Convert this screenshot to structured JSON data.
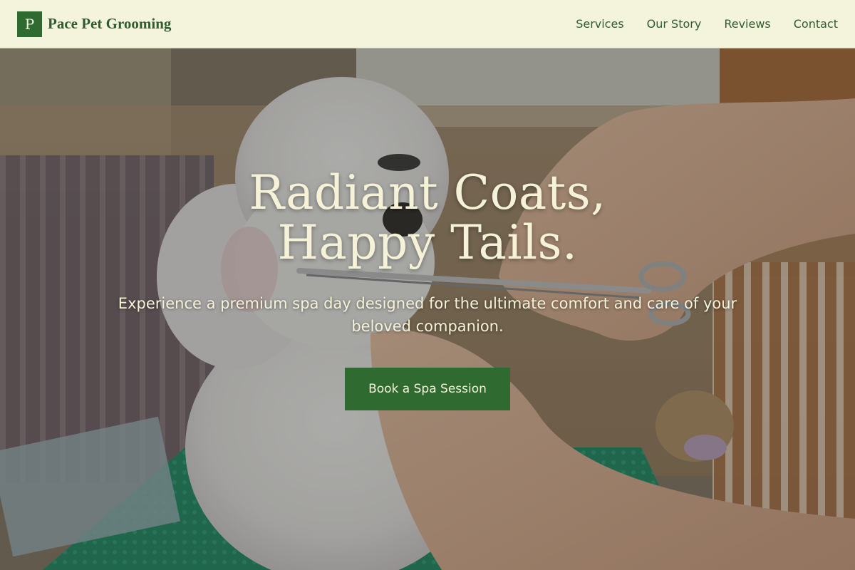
{
  "header": {
    "logo_letter": "P",
    "brand_name": "Pace Pet Grooming",
    "nav": [
      {
        "label": "Services"
      },
      {
        "label": "Our Story"
      },
      {
        "label": "Reviews"
      },
      {
        "label": "Contact"
      }
    ]
  },
  "hero": {
    "title": "Radiant Coats, Happy Tails.",
    "subtitle": "Experience a premium spa day designed for the ultimate comfort and care of your beloved companion.",
    "cta_label": "Book a Spa Session",
    "background_image": "photo of a white poodle being groomed with scissors on a green grooming table"
  },
  "colors": {
    "header_bg": "#f4f4dc",
    "brand_green": "#2f6a31",
    "text_cream": "#f6f2d8"
  }
}
